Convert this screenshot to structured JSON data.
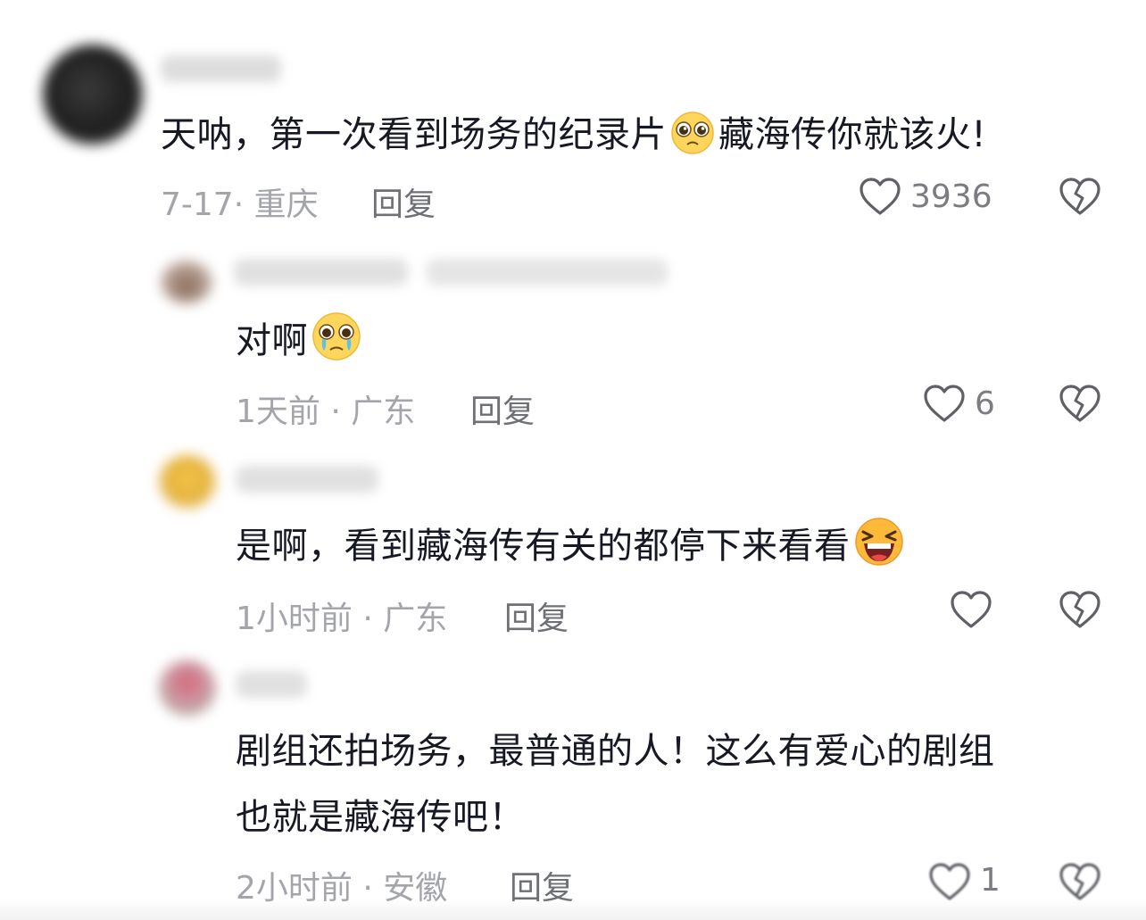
{
  "comments": [
    {
      "text_a": "天呐，第一次看到场务的纪录片",
      "emoji_a": "pleading-face-emoji",
      "text_b": "藏海传你就该火!",
      "meta": "7-17· 重庆",
      "reply": "回复",
      "likes": "3936"
    },
    {
      "text": "对啊",
      "emoji": "crying-pleading-face-emoji",
      "meta": "1天前 · 广东",
      "reply": "回复",
      "likes": "6"
    },
    {
      "text": "是啊，看到藏海传有关的都停下来看看",
      "emoji": "laughing-squint-face-emoji",
      "meta": "1小时前 · 广东",
      "reply": "回复",
      "likes": ""
    },
    {
      "line1": "剧组还拍场务，最普通的人！这么有爱心的剧组",
      "line2": "也就是藏海传吧！",
      "meta": "2小时前 · 安徽",
      "reply": "回复",
      "likes": "1"
    }
  ],
  "icons": {
    "like": "heart-outline-icon",
    "dislike": "broken-heart-icon"
  },
  "colors": {
    "text": "#161823",
    "meta": "#a3a5ab",
    "reply": "#6e7076",
    "icon": "#5f6166"
  }
}
